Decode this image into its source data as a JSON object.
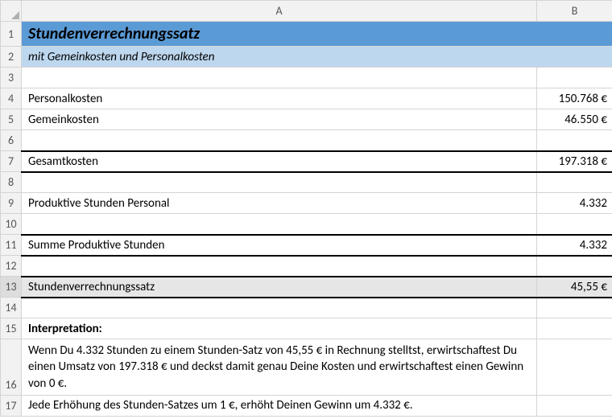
{
  "columns": {
    "A": "A",
    "B": "B"
  },
  "rows": {
    "r1": "1",
    "r2": "2",
    "r3": "3",
    "r4": "4",
    "r5": "5",
    "r6": "6",
    "r7": "7",
    "r8": "8",
    "r9": "9",
    "r10": "10",
    "r11": "11",
    "r12": "12",
    "r13": "13",
    "r14": "14",
    "r15": "15",
    "r16": "16",
    "r17": "17"
  },
  "cells": {
    "A1": "Stundenverrechnungssatz",
    "A2": "mit Gemeinkosten und Personalkosten",
    "A4": "Personalkosten",
    "B4": "150.768 €",
    "A5": "Gemeinkosten",
    "B5": "46.550 €",
    "A7": "Gesamtkosten",
    "B7": "197.318 €",
    "A9": "Produktive Stunden Personal",
    "B9": "4.332",
    "A11": "Summe Produktive Stunden",
    "B11": "4.332",
    "A13": "Stundenverrechnungssatz",
    "B13": "45,55 €",
    "A15": "Interpretation:",
    "A16": "Wenn Du 4.332 Stunden zu einem Stunden-Satz von 45,55 € in Rechnung stelltst, erwirtschaftest Du einen Umsatz von 197.318 € und deckst damit genau Deine Kosten und erwirtschaftest einen Gewinn von 0 €.",
    "A17": "Jede Erhöhung des Stunden-Satzes um 1 €, erhöht Deinen Gewinn um 4.332 €."
  }
}
